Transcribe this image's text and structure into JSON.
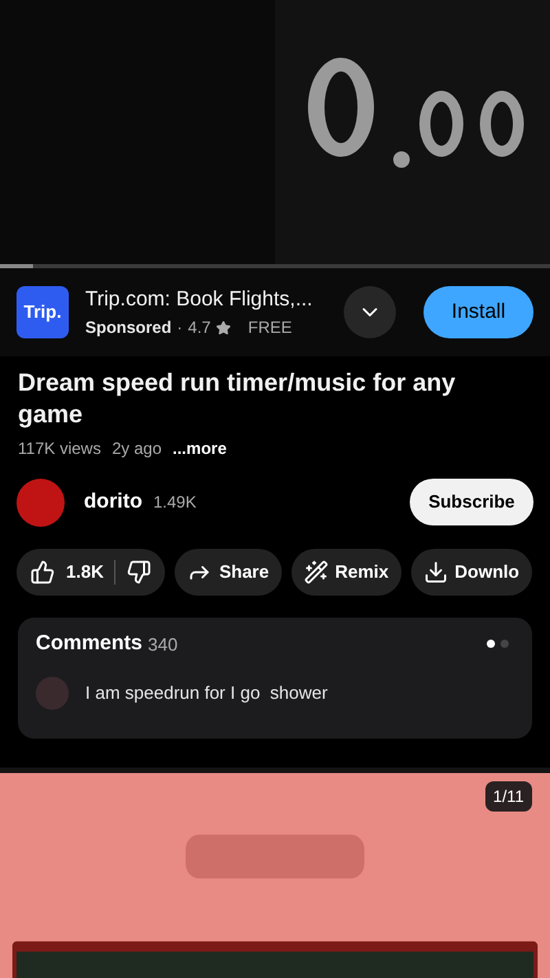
{
  "video": {
    "kind": "picture",
    "progress": {
      "level": 0.06
    }
  },
  "ad": {
    "logo": "Trip.",
    "title": "Trip.com: Book Flights,...",
    "sponsored": "Sponsored",
    "separator": "·",
    "rating": "4.7",
    "price": "FREE",
    "button": "Install"
  },
  "title": "Dream speed run timer/music for any game",
  "meta": {
    "views": "117K views",
    "age": "2y ago",
    "more": "...more"
  },
  "channel": {
    "name": "dorito",
    "subscribers": "1.49K",
    "button": "Subscribe"
  },
  "actions": [
    {
      "kind": "like",
      "label": "1.8K"
    },
    {
      "kind": "share",
      "label": "Share"
    },
    {
      "kind": "remix",
      "label": "Remix"
    },
    {
      "kind": "download",
      "label": "Downlo"
    }
  ],
  "comments": {
    "title": "Comments",
    "count": "340",
    "pages": [
      {
        "selected": true
      },
      {
        "selected": false
      }
    ],
    "top_comment": "I am speedrun for I go  shower"
  },
  "promo": {
    "kind": "picture",
    "counter": "1/11"
  }
}
